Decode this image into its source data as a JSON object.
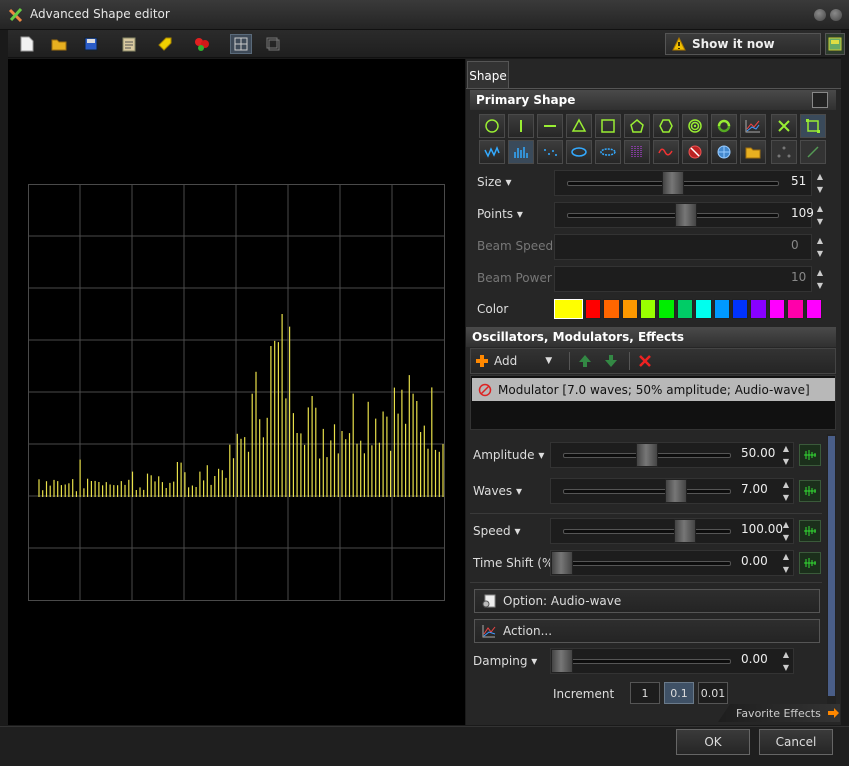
{
  "window": {
    "title": "Advanced Shape editor"
  },
  "toolbar": {
    "icons": [
      "new-file-icon",
      "open-folder-icon",
      "save-icon",
      "clipboard-icon",
      "tag-icon",
      "effects-icon",
      "grid-view-icon",
      "single-view-icon"
    ],
    "show_label": "Show it now"
  },
  "tabs": [
    {
      "label": "Shape"
    }
  ],
  "primary_shape": {
    "header": "Primary Shape",
    "shape_icons_row1": [
      "circle-icon",
      "vertical-line-icon",
      "horizontal-line-icon",
      "triangle-icon",
      "square-icon",
      "pentagon-icon",
      "hexagon-icon",
      "spiral-icon",
      "swirl-icon",
      "chart-icon",
      "cross-icon",
      "frame-icon"
    ],
    "shape_icons_row2": [
      "wave-icon",
      "audio-bars-icon",
      "dots-icon",
      "ellipse-icon",
      "ring-icon",
      "grid-dots-icon",
      "sine-icon",
      "no-icon",
      "globe-icon",
      "folder-icon",
      "triangle-points-icon",
      "diagonal-line-icon"
    ],
    "size": {
      "label": "Size",
      "value": "51",
      "fraction": 0.5
    },
    "points": {
      "label": "Points",
      "value": "109",
      "fraction": 0.57
    },
    "beam_speed": {
      "label": "Beam Speed",
      "value": "0"
    },
    "beam_power": {
      "label": "Beam Power",
      "value": "10"
    },
    "color": {
      "label": "Color",
      "swatches": [
        "#ffff00",
        "#ff0000",
        "#ff6600",
        "#ff9900",
        "#99ff00",
        "#00ee00",
        "#00cc66",
        "#00ffee",
        "#0099ff",
        "#0033ff",
        "#8800ff",
        "#ff00ff",
        "#ff00aa",
        "#ff00ff"
      ]
    }
  },
  "oscillators": {
    "header": "Oscillators, Modulators, Effects",
    "add_label": "Add",
    "items": [
      {
        "label": "Modulator [7.0 waves; 50% amplitude; Audio-wave]"
      }
    ]
  },
  "params": {
    "amplitude": {
      "label": "Amplitude",
      "value": "50.00",
      "fraction": 0.5
    },
    "waves": {
      "label": "Waves",
      "value": "7.00",
      "fraction": 0.7
    },
    "speed": {
      "label": "Speed",
      "value": "100.00",
      "fraction": 0.76
    },
    "time_shift": {
      "label": "Time Shift (%)",
      "value": "0.00",
      "fraction": 0.0
    },
    "option_label": "Option: Audio-wave",
    "action_label": "Action...",
    "damping": {
      "label": "Damping",
      "value": "0.00",
      "fraction": 0.0
    },
    "increment": {
      "label": "Increment",
      "options": [
        "1",
        "0.1",
        "0.01"
      ],
      "selected": "0.1"
    }
  },
  "favorite_effects_label": "Favorite Effects",
  "buttons": {
    "ok": "OK",
    "cancel": "Cancel"
  }
}
